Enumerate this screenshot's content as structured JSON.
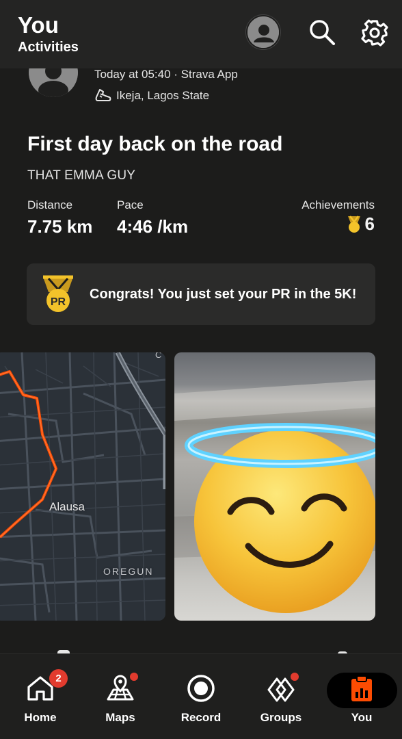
{
  "header": {
    "title": "You",
    "subtitle": "Activities",
    "icons": [
      "avatar-icon",
      "search-icon",
      "gear-icon"
    ]
  },
  "activity": {
    "meta_time": "Today at 05:40 · Strava App",
    "location": "Ikeja, Lagos State",
    "title": "First day back on the road",
    "athlete": "THAT EMMA GUY",
    "stats": {
      "distance_label": "Distance",
      "distance_value": "7.75 km",
      "pace_label": "Pace",
      "pace_value": "4:46 /km",
      "achievements_label": "Achievements",
      "achievements_value": "6"
    },
    "pr_card": {
      "text": "Congrats! You just set your PR in the 5K!",
      "medal_text": "PR"
    },
    "map": {
      "label_primary": "Alausa",
      "label_secondary": "OREGUN",
      "edge_letter": "C"
    }
  },
  "nav": {
    "items": [
      {
        "label": "Home",
        "icon": "home-icon",
        "badge": "2"
      },
      {
        "label": "Maps",
        "icon": "map-icon"
      },
      {
        "label": "Record",
        "icon": "record-icon"
      },
      {
        "label": "Groups",
        "icon": "groups-icon"
      },
      {
        "label": "You",
        "icon": "you-icon"
      }
    ]
  },
  "colors": {
    "background": "#1c1c1b",
    "card": "#2b2b2a",
    "accent": "#fc4c02",
    "badge": "#e23b2e",
    "medal_gold": "#f3c32a"
  }
}
